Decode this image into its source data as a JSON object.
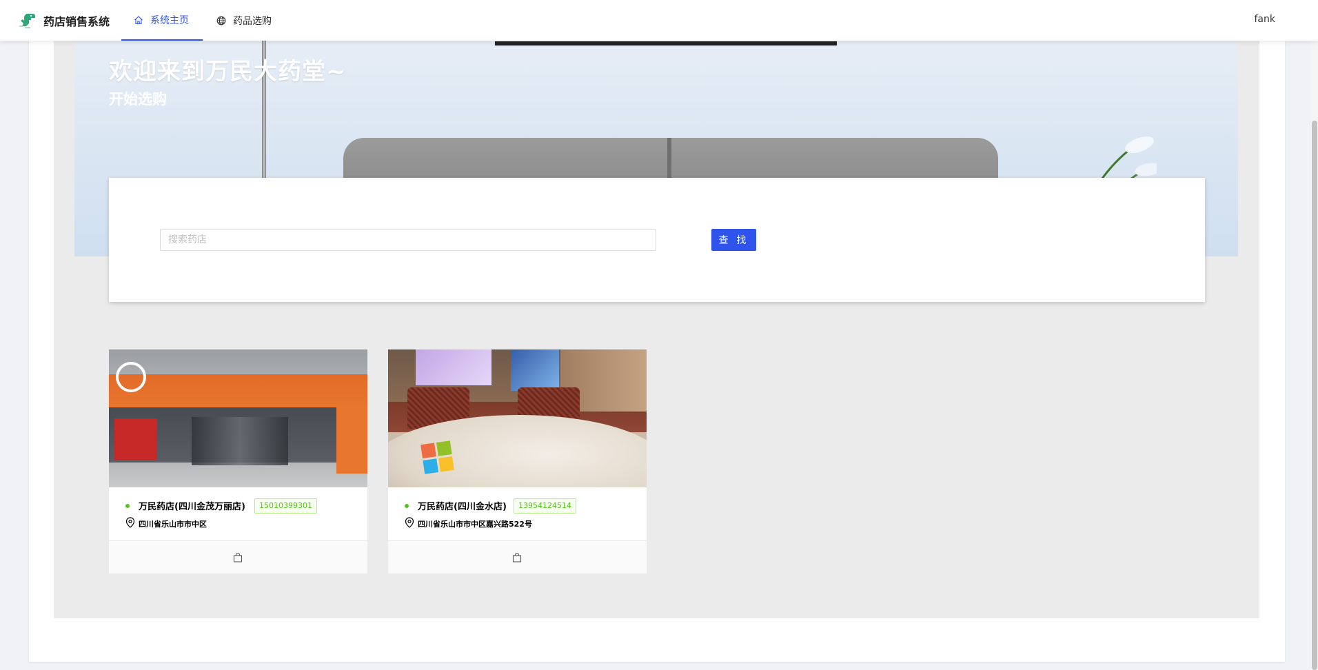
{
  "header": {
    "brand": "药店销售系统",
    "nav": [
      {
        "label": "系统主页",
        "active": true
      },
      {
        "label": "药品选购",
        "active": false
      }
    ],
    "user": "fank"
  },
  "banner": {
    "title": "欢迎来到万民大药堂~",
    "subtitle": "开始选购"
  },
  "search": {
    "placeholder": "搜索药店",
    "value": "",
    "button_label": "查 找"
  },
  "stores": [
    {
      "name": "万民药店(四川金茂万丽店)",
      "phone": "15010399301",
      "address": "四川省乐山市市中区"
    },
    {
      "name": "万民药店(四川金水店)",
      "phone": "13954124514",
      "address": "四川省乐山市市中区嘉兴路522号"
    }
  ],
  "colors": {
    "primary": "#2f54eb",
    "status_green": "#52c41a",
    "content_bg": "#ebebeb"
  },
  "icons": [
    "dinosaur-logo-icon",
    "home-icon",
    "globe-icon",
    "location-pin-icon",
    "shopping-bag-icon"
  ]
}
